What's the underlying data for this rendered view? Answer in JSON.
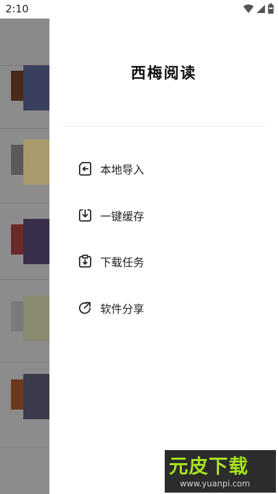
{
  "status_bar": {
    "time": "2:10",
    "icons": [
      "wifi-icon",
      "signal-icon",
      "battery-icon"
    ]
  },
  "drawer": {
    "title": "西梅阅读",
    "menu": [
      {
        "label": "本地导入",
        "icon": "import-icon"
      },
      {
        "label": "一键缓存",
        "icon": "download-icon"
      },
      {
        "label": "下载任务",
        "icon": "download-task-icon"
      },
      {
        "label": "软件分享",
        "icon": "share-icon"
      }
    ]
  },
  "watermark": {
    "text": "元皮下载",
    "url": "www.yuanpi.com"
  },
  "colors": {
    "scrim": "#8c8c8c",
    "drawer_bg": "#ffffff",
    "text": "#222222",
    "watermark_accent": "#a6e21c"
  }
}
